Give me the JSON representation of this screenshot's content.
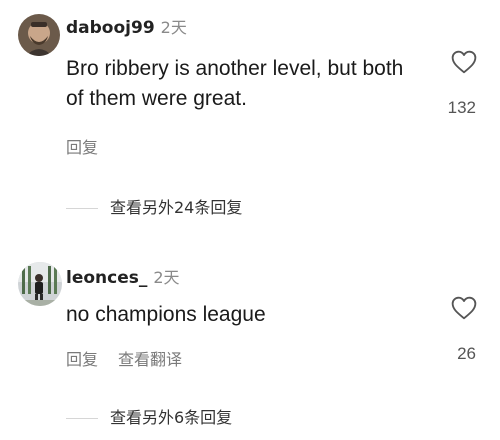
{
  "comments": [
    {
      "username": "dabooj99",
      "time": "2天",
      "text": "Bro ribbery is another level, but both of them were great.",
      "actions": [
        "回复"
      ],
      "likes": "132",
      "view_replies": "查看另外24条回复"
    },
    {
      "username": "leonces_",
      "time": "2天",
      "text": "no champions league",
      "actions": [
        "回复",
        "查看翻译"
      ],
      "likes": "26",
      "view_replies": "查看另外6条回复"
    }
  ],
  "colors": {
    "text_primary": "#1a1a1a",
    "text_secondary": "#7a7a7a",
    "divider": "#d6d6d6"
  }
}
